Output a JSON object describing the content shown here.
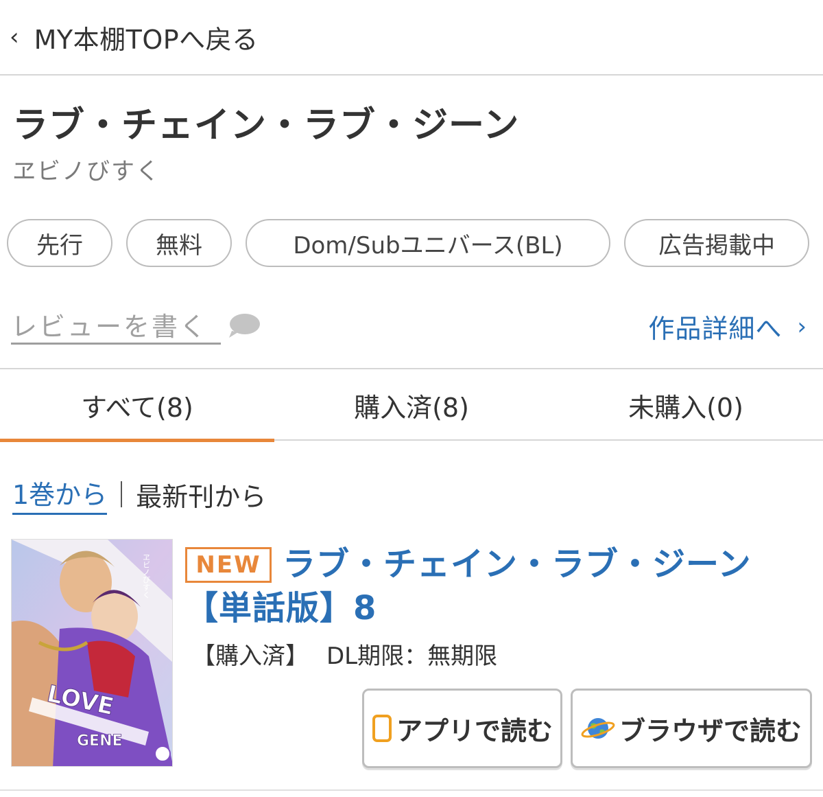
{
  "back": {
    "label": "MY本棚TOPへ戻る"
  },
  "series": {
    "title": "ラブ・チェイン・ラブ・ジーン",
    "author": "ヱビノびすく"
  },
  "tags": [
    "先行",
    "無料",
    "Dom/Subユニバース(BL)",
    "広告掲載中"
  ],
  "review": {
    "label": "レビューを書く"
  },
  "details": {
    "label": "作品詳細へ"
  },
  "tabs": [
    {
      "label": "すべて(8)",
      "active": true
    },
    {
      "label": "購入済(8)",
      "active": false
    },
    {
      "label": "未購入(0)",
      "active": false
    }
  ],
  "sort": {
    "option1": "1巻から",
    "option2": "最新刊から"
  },
  "item": {
    "badge": "NEW",
    "title": "ラブ・チェイン・ラブ・ジーン【単話版】8",
    "purchased": "【購入済】",
    "dl_limit": "DL期限：無期限",
    "cover_text": "LOVE",
    "cover_text2": "GENE",
    "cover_author": "ヱビノびすく",
    "app_button": "アプリで読む",
    "browser_button": "ブラウザで読む"
  },
  "colors": {
    "accent_orange": "#e8873a",
    "link_blue": "#2a6fb5",
    "border_gray": "#bdbdbd"
  }
}
